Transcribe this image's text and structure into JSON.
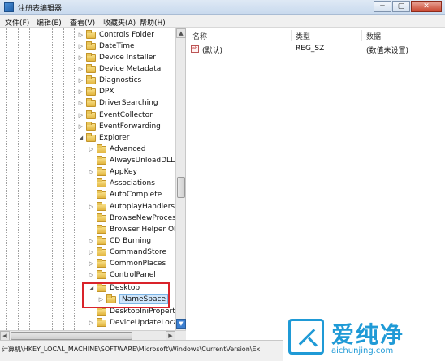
{
  "window": {
    "title": "注册表编辑器",
    "controls": [
      "─",
      "▢",
      "✕"
    ]
  },
  "menu": [
    "文件(F)",
    "编辑(E)",
    "查看(V)",
    "收藏夹(A)",
    "帮助(H)"
  ],
  "tree": {
    "items": [
      {
        "label": "Controls Folder",
        "expander": "▷"
      },
      {
        "label": "DateTime",
        "expander": "▷"
      },
      {
        "label": "Device Installer",
        "expander": "▷"
      },
      {
        "label": "Device Metadata",
        "expander": "▷"
      },
      {
        "label": "Diagnostics",
        "expander": "▷"
      },
      {
        "label": "DPX",
        "expander": "▷"
      },
      {
        "label": "DriverSearching",
        "expander": "▷"
      },
      {
        "label": "EventCollector",
        "expander": "▷"
      },
      {
        "label": "EventForwarding",
        "expander": "▷"
      },
      {
        "label": "Explorer",
        "expander": "◢"
      },
      {
        "label": "Advanced",
        "expander": "▷"
      },
      {
        "label": "AlwaysUnloadDLL",
        "expander": ""
      },
      {
        "label": "AppKey",
        "expander": "▷"
      },
      {
        "label": "Associations",
        "expander": ""
      },
      {
        "label": "AutoComplete",
        "expander": ""
      },
      {
        "label": "AutoplayHandlers",
        "expander": "▷"
      },
      {
        "label": "BrowseNewProcess",
        "expander": ""
      },
      {
        "label": "Browser Helper Obj",
        "expander": ""
      },
      {
        "label": "CD Burning",
        "expander": "▷"
      },
      {
        "label": "CommandStore",
        "expander": "▷"
      },
      {
        "label": "CommonPlaces",
        "expander": "▷"
      },
      {
        "label": "ControlPanel",
        "expander": "▷"
      },
      {
        "label": "Desktop",
        "expander": "◢"
      },
      {
        "label": "NameSpace",
        "expander": "▷"
      },
      {
        "label": "DesktopIniProperty",
        "expander": ""
      },
      {
        "label": "DeviceUpdateLocati",
        "expander": "▷"
      }
    ]
  },
  "list": {
    "columns": [
      "名称",
      "类型",
      "数据"
    ],
    "rows": [
      {
        "icon": "ab",
        "name": "(默认)",
        "type": "REG_SZ",
        "data": "(数值未设置)"
      }
    ]
  },
  "status": {
    "path": "计算机\\HKEY_LOCAL_MACHINE\\SOFTWARE\\Microsoft\\Windows\\CurrentVersion\\Ex"
  },
  "watermark": {
    "title": "爱纯净",
    "url": "aichunjing.com"
  },
  "colors": {
    "highlight": "#d9232a",
    "selection": "#cfe6fb",
    "watermark": "#1f9ad6"
  }
}
